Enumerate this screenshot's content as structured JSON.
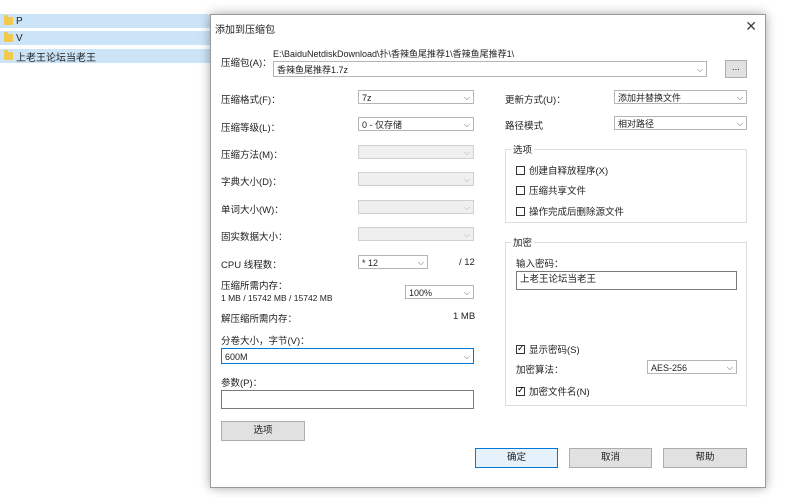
{
  "background_list": {
    "items": [
      {
        "name": "P",
        "selected": true
      },
      {
        "name": "V",
        "selected": true
      },
      {
        "name": "上老王论坛当老王",
        "selected": true
      }
    ]
  },
  "dialog": {
    "title": "添加到压缩包",
    "archive": {
      "label": "压缩包(A)：",
      "path": "E:\\BaiduNetdiskDownload\\扑\\香辣鱼尾推荐1\\香辣鱼尾推荐1\\",
      "filename": "香辣鱼尾推荐1.7z",
      "browse_label": "..."
    },
    "left": {
      "format": {
        "label": "压缩格式(F)：",
        "value": "7z"
      },
      "level": {
        "label": "压缩等级(L)：",
        "value": "0 - 仅存储"
      },
      "method": {
        "label": "压缩方法(M)：",
        "value": ""
      },
      "dict": {
        "label": "字典大小(D)：",
        "value": ""
      },
      "word": {
        "label": "单词大小(W)：",
        "value": ""
      },
      "solid": {
        "label": "固实数据大小：",
        "value": ""
      },
      "cpu": {
        "label": "CPU 线程数：",
        "value": "* 12",
        "max": "/ 12"
      },
      "mem_comp": {
        "label": "压缩所需内存：",
        "detail": "1 MB / 15742 MB / 15742 MB",
        "value": "100%"
      },
      "mem_decomp": {
        "label": "解压缩所需内存：",
        "value": "1 MB"
      },
      "split": {
        "label": "分卷大小，字节(V)：",
        "value": "600M"
      },
      "params": {
        "label": "参数(P)：",
        "value": ""
      },
      "options_button": "选项"
    },
    "right": {
      "update": {
        "label": "更新方式(U)：",
        "value": "添加并替换文件"
      },
      "pathmode": {
        "label": "路径模式",
        "value": "相对路径"
      },
      "options_group": {
        "title": "选项",
        "sfx": "创建自释放程序(X)",
        "shared": "压缩共享文件",
        "delete_after": "操作完成后删除源文件"
      },
      "encryption": {
        "title": "加密",
        "password_label": "输入密码：",
        "password_value": "上老王论坛当老王",
        "show_password": "显示密码(S)",
        "method_label": "加密算法：",
        "method_value": "AES-256",
        "encrypt_names": "加密文件名(N)"
      }
    },
    "buttons": {
      "ok": "确定",
      "cancel": "取消",
      "help": "帮助"
    }
  }
}
